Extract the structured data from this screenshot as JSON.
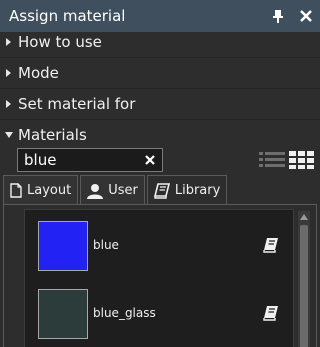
{
  "window": {
    "title": "Assign material",
    "pin_icon": "pin-icon",
    "close_icon": "close-icon"
  },
  "sections": [
    {
      "label": "How to use",
      "expanded": false
    },
    {
      "label": "Mode",
      "expanded": false
    },
    {
      "label": "Set material for",
      "expanded": false
    },
    {
      "label": "Materials",
      "expanded": true
    }
  ],
  "materials": {
    "search": {
      "value": "blue"
    },
    "view_modes": [
      "list-view-icon",
      "grid-view-icon"
    ],
    "active_view": "grid-view-icon",
    "tabs": [
      {
        "label": "Layout",
        "icon": "document-icon"
      },
      {
        "label": "User",
        "icon": "user-icon"
      },
      {
        "label": "Library",
        "icon": "book-icon",
        "active": true
      }
    ],
    "items": [
      {
        "name": "blue",
        "color": "#2222f5",
        "icon": "book-icon"
      },
      {
        "name": "blue_glass",
        "color": "#2c3c3a",
        "icon": "book-icon"
      }
    ]
  },
  "colors": {
    "titlebar": "#3f4f5d",
    "background": "#2d2d2d"
  }
}
